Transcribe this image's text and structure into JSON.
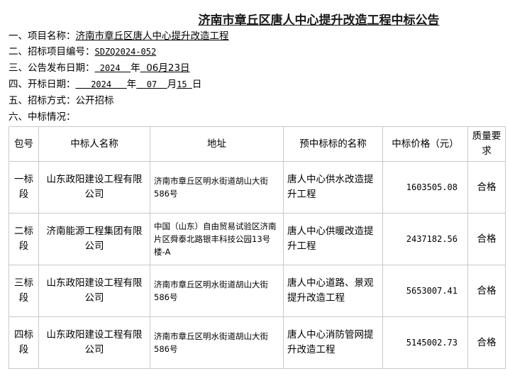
{
  "title": "济南市章丘区唐人中心提升改造工程中标公告",
  "info": {
    "project_name_label": "一、项目名称：",
    "project_name": "济南市章丘区唐人中心提升改造工程",
    "project_no_label": "二、招标项目编号：",
    "project_no": "SDZQ2024-052",
    "publish_date_label": "三、公告发布日期：",
    "publish_year": "2024",
    "publish_year_unit": "年",
    "publish_monthday": "06月23日",
    "open_date_label": "四、开标日期：",
    "open_year": "2024",
    "open_year_unit": "年",
    "open_month": "07",
    "open_month_unit": "月",
    "open_day": "15",
    "open_day_unit": "日",
    "method_label": "五、招标方式：",
    "method": "公开招标",
    "result_label": "六、中标情况："
  },
  "table": {
    "headers": [
      "包号",
      "中标人名称",
      "地址",
      "预中标标的名称",
      "中标价格（元）",
      "质量要求"
    ],
    "rows": [
      {
        "package": "一标段",
        "bidder": "山东政阳建设工程有限公司",
        "address": "济南市章丘区明水街道胡山大街586号",
        "item": "唐人中心供水改造提升工程",
        "price": "1603505.08",
        "quality": "合格"
      },
      {
        "package": "二标段",
        "bidder": "济南能源工程集团有限公司",
        "address": "中国（山东）自由贸易试验区济南片区舜泰北路银丰科技公园13号楼-A",
        "item": "唐人中心供暖改造提升工程",
        "price": "2437182.56",
        "quality": "合格"
      },
      {
        "package": "三标段",
        "bidder": "山东政阳建设工程有限公司",
        "address": "济南市章丘区明水街道胡山大街586号",
        "item": "唐人中心道路、景观提升改造工程",
        "price": "5653007.41",
        "quality": "合格"
      },
      {
        "package": "四标段",
        "bidder": "山东政阳建设工程有限公司",
        "address": "济南市章丘区明水街道胡山大街586号",
        "item": "唐人中心消防管网提升改造工程",
        "price": "5145002.73",
        "quality": "合格"
      }
    ]
  }
}
